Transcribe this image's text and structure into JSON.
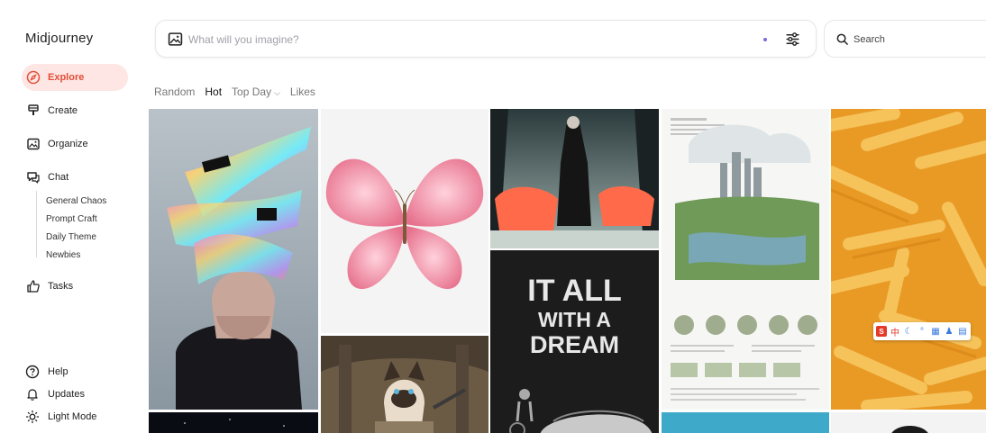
{
  "app": {
    "brand": "Midjourney"
  },
  "nav": {
    "explore": "Explore",
    "create": "Create",
    "organize": "Organize",
    "chat": "Chat",
    "chat_rooms": [
      "General Chaos",
      "Prompt Craft",
      "Daily Theme",
      "Newbies"
    ],
    "tasks": "Tasks"
  },
  "footer": {
    "help": "Help",
    "updates": "Updates",
    "light_mode": "Light Mode"
  },
  "prompt": {
    "placeholder": "What will you imagine?"
  },
  "search": {
    "placeholder": "Search"
  },
  "filters": {
    "random": "Random",
    "hot": "Hot",
    "top_day": "Top Day",
    "likes": "Likes",
    "active": "Hot"
  },
  "tiles": {
    "poster_text": {
      "line1": "IT ALL",
      "line2": "WITH A",
      "line3": "DREAM"
    }
  },
  "float_toolbar": {
    "first_char": "中"
  },
  "colors": {
    "accent": "#e24f3a",
    "accent_bg": "#fde6e3",
    "dot": "#7a6ae0"
  },
  "icons": {
    "explore": "compass-icon",
    "create": "paintbrush-icon",
    "organize": "image-icon",
    "chat": "chat-bubble-icon",
    "tasks": "thumbs-up-icon",
    "help": "question-icon",
    "updates": "bell-icon",
    "light_mode": "sun-icon",
    "prompt": "image-icon",
    "settings": "sliders-icon",
    "search": "search-icon"
  }
}
